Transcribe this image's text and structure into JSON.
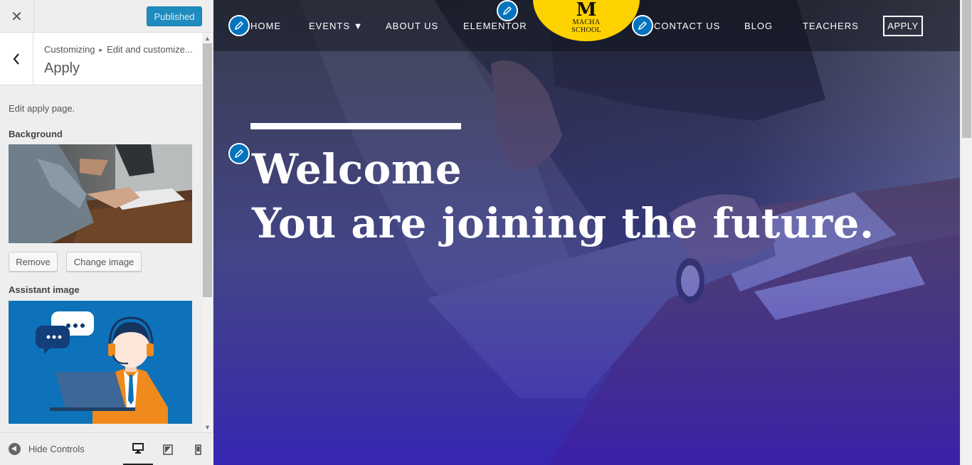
{
  "header": {
    "close_label": "✕",
    "publish_button": "Published"
  },
  "section": {
    "breadcrumb_parent": "Customizing",
    "breadcrumb_sep": "▸",
    "breadcrumb_current": "Edit and customize...",
    "title": "Apply",
    "description": "Edit apply page."
  },
  "controls": {
    "background_label": "Background",
    "remove_button": "Remove",
    "change_image_button": "Change image",
    "assistant_label": "Assistant image"
  },
  "footer": {
    "hide_controls": "Hide Controls",
    "devices": [
      "desktop-icon",
      "tablet-icon",
      "mobile-icon"
    ]
  },
  "preview": {
    "nav": {
      "home": "HOME",
      "events": "EVENTS ▼",
      "about": "ABOUT US",
      "elementor": "ELEMENTOR",
      "contact": "CONTACT US",
      "blog": "BLOG",
      "teachers": "TEACHERS",
      "apply": "APPLY"
    },
    "logo": {
      "letter": "M",
      "line1": "MACHA",
      "line2": "SCHOOL"
    },
    "hero": {
      "line1": "Welcome",
      "line2": "You are joining the future."
    }
  },
  "colors": {
    "publish_blue": "#1e8cbe",
    "edit_pen_blue": "#0274be",
    "logo_yellow": "#fed200",
    "hero_overlay": "#3b3fb5"
  }
}
